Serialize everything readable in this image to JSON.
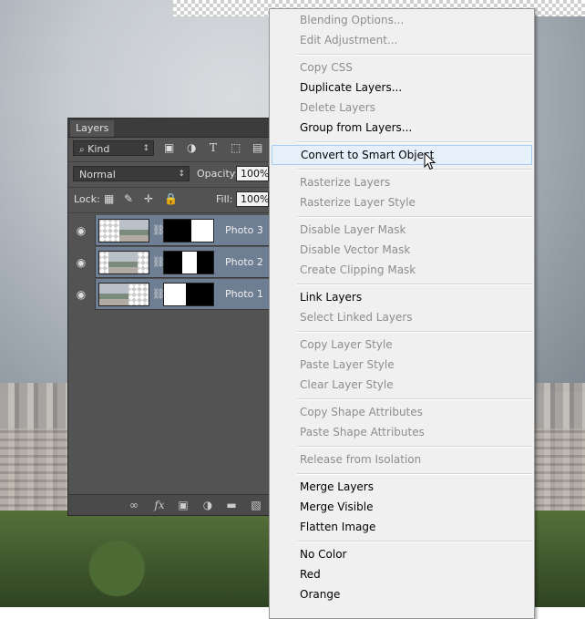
{
  "layers_panel": {
    "tab_label": "Layers",
    "filter_kind": "Kind",
    "blend_mode": "Normal",
    "opacity_label": "Opacity:",
    "opacity_value": "100%",
    "lock_label": "Lock:",
    "fill_label": "Fill:",
    "fill_value": "100%",
    "layers": [
      {
        "name": "Photo 3",
        "selected": true
      },
      {
        "name": "Photo 2",
        "selected": true
      },
      {
        "name": "Photo 1",
        "selected": true
      }
    ],
    "footer_icons": [
      "link-icon",
      "fx-icon",
      "mask-icon",
      "adjustment-icon",
      "folder-icon",
      "new-layer-icon"
    ]
  },
  "context_menu": {
    "items": [
      {
        "label": "Blending Options...",
        "disabled": true
      },
      {
        "label": "Edit Adjustment...",
        "disabled": true
      },
      {
        "label": "Copy CSS",
        "disabled": true
      },
      {
        "label": "Duplicate Layers...",
        "disabled": false
      },
      {
        "label": "Delete Layers",
        "disabled": true
      },
      {
        "label": "Group from Layers...",
        "disabled": false
      },
      {
        "label": "Convert to Smart Object",
        "disabled": false,
        "highlighted": true
      },
      {
        "label": "Rasterize Layers",
        "disabled": true
      },
      {
        "label": "Rasterize Layer Style",
        "disabled": true
      },
      {
        "label": "Disable Layer Mask",
        "disabled": true
      },
      {
        "label": "Disable Vector Mask",
        "disabled": true
      },
      {
        "label": "Create Clipping Mask",
        "disabled": true
      },
      {
        "label": "Link Layers",
        "disabled": false
      },
      {
        "label": "Select Linked Layers",
        "disabled": true
      },
      {
        "label": "Copy Layer Style",
        "disabled": true
      },
      {
        "label": "Paste Layer Style",
        "disabled": true
      },
      {
        "label": "Clear Layer Style",
        "disabled": true
      },
      {
        "label": "Copy Shape Attributes",
        "disabled": true
      },
      {
        "label": "Paste Shape Attributes",
        "disabled": true
      },
      {
        "label": "Release from Isolation",
        "disabled": true
      },
      {
        "label": "Merge Layers",
        "disabled": false
      },
      {
        "label": "Merge Visible",
        "disabled": false
      },
      {
        "label": "Flatten Image",
        "disabled": false
      },
      {
        "label": "No Color",
        "disabled": false
      },
      {
        "label": "Red",
        "disabled": false
      },
      {
        "label": "Orange",
        "disabled": false
      }
    ]
  },
  "colors": {
    "panel_bg": "#535353",
    "selected_layer": "#6e7e93",
    "menu_bg": "#f0f0f0",
    "menu_highlight": "#e5f0fb",
    "disabled_text": "#8d8d8d"
  }
}
